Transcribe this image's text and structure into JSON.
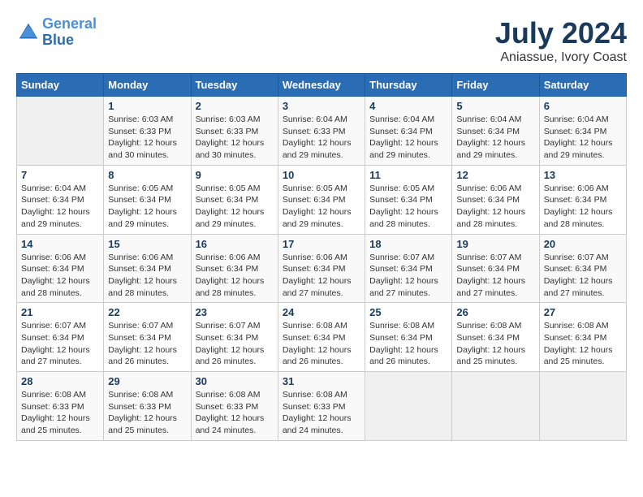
{
  "header": {
    "logo_line1": "General",
    "logo_line2": "Blue",
    "month_year": "July 2024",
    "location": "Aniassue, Ivory Coast"
  },
  "weekdays": [
    "Sunday",
    "Monday",
    "Tuesday",
    "Wednesday",
    "Thursday",
    "Friday",
    "Saturday"
  ],
  "weeks": [
    [
      {
        "day": "",
        "info": ""
      },
      {
        "day": "1",
        "info": "Sunrise: 6:03 AM\nSunset: 6:33 PM\nDaylight: 12 hours\nand 30 minutes."
      },
      {
        "day": "2",
        "info": "Sunrise: 6:03 AM\nSunset: 6:33 PM\nDaylight: 12 hours\nand 30 minutes."
      },
      {
        "day": "3",
        "info": "Sunrise: 6:04 AM\nSunset: 6:33 PM\nDaylight: 12 hours\nand 29 minutes."
      },
      {
        "day": "4",
        "info": "Sunrise: 6:04 AM\nSunset: 6:34 PM\nDaylight: 12 hours\nand 29 minutes."
      },
      {
        "day": "5",
        "info": "Sunrise: 6:04 AM\nSunset: 6:34 PM\nDaylight: 12 hours\nand 29 minutes."
      },
      {
        "day": "6",
        "info": "Sunrise: 6:04 AM\nSunset: 6:34 PM\nDaylight: 12 hours\nand 29 minutes."
      }
    ],
    [
      {
        "day": "7",
        "info": "Sunrise: 6:04 AM\nSunset: 6:34 PM\nDaylight: 12 hours\nand 29 minutes."
      },
      {
        "day": "8",
        "info": "Sunrise: 6:05 AM\nSunset: 6:34 PM\nDaylight: 12 hours\nand 29 minutes."
      },
      {
        "day": "9",
        "info": "Sunrise: 6:05 AM\nSunset: 6:34 PM\nDaylight: 12 hours\nand 29 minutes."
      },
      {
        "day": "10",
        "info": "Sunrise: 6:05 AM\nSunset: 6:34 PM\nDaylight: 12 hours\nand 29 minutes."
      },
      {
        "day": "11",
        "info": "Sunrise: 6:05 AM\nSunset: 6:34 PM\nDaylight: 12 hours\nand 28 minutes."
      },
      {
        "day": "12",
        "info": "Sunrise: 6:06 AM\nSunset: 6:34 PM\nDaylight: 12 hours\nand 28 minutes."
      },
      {
        "day": "13",
        "info": "Sunrise: 6:06 AM\nSunset: 6:34 PM\nDaylight: 12 hours\nand 28 minutes."
      }
    ],
    [
      {
        "day": "14",
        "info": "Sunrise: 6:06 AM\nSunset: 6:34 PM\nDaylight: 12 hours\nand 28 minutes."
      },
      {
        "day": "15",
        "info": "Sunrise: 6:06 AM\nSunset: 6:34 PM\nDaylight: 12 hours\nand 28 minutes."
      },
      {
        "day": "16",
        "info": "Sunrise: 6:06 AM\nSunset: 6:34 PM\nDaylight: 12 hours\nand 28 minutes."
      },
      {
        "day": "17",
        "info": "Sunrise: 6:06 AM\nSunset: 6:34 PM\nDaylight: 12 hours\nand 27 minutes."
      },
      {
        "day": "18",
        "info": "Sunrise: 6:07 AM\nSunset: 6:34 PM\nDaylight: 12 hours\nand 27 minutes."
      },
      {
        "day": "19",
        "info": "Sunrise: 6:07 AM\nSunset: 6:34 PM\nDaylight: 12 hours\nand 27 minutes."
      },
      {
        "day": "20",
        "info": "Sunrise: 6:07 AM\nSunset: 6:34 PM\nDaylight: 12 hours\nand 27 minutes."
      }
    ],
    [
      {
        "day": "21",
        "info": "Sunrise: 6:07 AM\nSunset: 6:34 PM\nDaylight: 12 hours\nand 27 minutes."
      },
      {
        "day": "22",
        "info": "Sunrise: 6:07 AM\nSunset: 6:34 PM\nDaylight: 12 hours\nand 26 minutes."
      },
      {
        "day": "23",
        "info": "Sunrise: 6:07 AM\nSunset: 6:34 PM\nDaylight: 12 hours\nand 26 minutes."
      },
      {
        "day": "24",
        "info": "Sunrise: 6:08 AM\nSunset: 6:34 PM\nDaylight: 12 hours\nand 26 minutes."
      },
      {
        "day": "25",
        "info": "Sunrise: 6:08 AM\nSunset: 6:34 PM\nDaylight: 12 hours\nand 26 minutes."
      },
      {
        "day": "26",
        "info": "Sunrise: 6:08 AM\nSunset: 6:34 PM\nDaylight: 12 hours\nand 25 minutes."
      },
      {
        "day": "27",
        "info": "Sunrise: 6:08 AM\nSunset: 6:34 PM\nDaylight: 12 hours\nand 25 minutes."
      }
    ],
    [
      {
        "day": "28",
        "info": "Sunrise: 6:08 AM\nSunset: 6:33 PM\nDaylight: 12 hours\nand 25 minutes."
      },
      {
        "day": "29",
        "info": "Sunrise: 6:08 AM\nSunset: 6:33 PM\nDaylight: 12 hours\nand 25 minutes."
      },
      {
        "day": "30",
        "info": "Sunrise: 6:08 AM\nSunset: 6:33 PM\nDaylight: 12 hours\nand 24 minutes."
      },
      {
        "day": "31",
        "info": "Sunrise: 6:08 AM\nSunset: 6:33 PM\nDaylight: 12 hours\nand 24 minutes."
      },
      {
        "day": "",
        "info": ""
      },
      {
        "day": "",
        "info": ""
      },
      {
        "day": "",
        "info": ""
      }
    ]
  ]
}
